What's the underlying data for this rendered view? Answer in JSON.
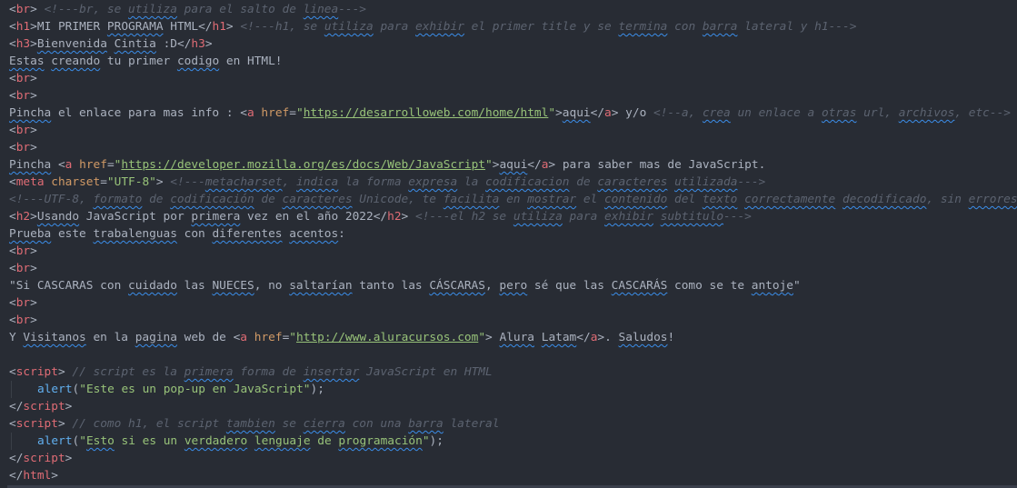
{
  "editor": {
    "theme_colors": {
      "background": "#282c34",
      "tag": "#e06c75",
      "attribute": "#d19a66",
      "string": "#98c379",
      "comment": "#5c6370",
      "text": "#abb2bf",
      "function": "#61afef",
      "spellcheck": "#3b8eea"
    },
    "lines": [
      [
        [
          "punct",
          "<"
        ],
        [
          "tag",
          "br"
        ],
        [
          "punct",
          ">"
        ],
        [
          "text",
          " "
        ],
        [
          "comment",
          "<!---br, se "
        ],
        [
          "comment-spell",
          "utiliza"
        ],
        [
          "comment",
          " para el salto de "
        ],
        [
          "comment-spell",
          "linea"
        ],
        [
          "comment",
          "--->"
        ]
      ],
      [
        [
          "punct",
          "<"
        ],
        [
          "tag",
          "h1"
        ],
        [
          "punct",
          ">"
        ],
        [
          "text",
          "MI PRIMER "
        ],
        [
          "text-spell",
          "PROGRAMA"
        ],
        [
          "text",
          " HTML"
        ],
        [
          "punct",
          "</"
        ],
        [
          "tag",
          "h1"
        ],
        [
          "punct",
          ">"
        ],
        [
          "text",
          " "
        ],
        [
          "comment",
          "<!---h1, se "
        ],
        [
          "comment-spell",
          "utiliza"
        ],
        [
          "comment",
          " para "
        ],
        [
          "comment-spell",
          "exhibir"
        ],
        [
          "comment",
          " el primer title y se "
        ],
        [
          "comment-spell",
          "termina"
        ],
        [
          "comment",
          " con "
        ],
        [
          "comment-spell",
          "barra"
        ],
        [
          "comment",
          " lateral y h1--->"
        ]
      ],
      [
        [
          "punct",
          "<"
        ],
        [
          "tag",
          "h3"
        ],
        [
          "punct",
          ">"
        ],
        [
          "text-spell",
          "Bienvenida"
        ],
        [
          "text",
          " "
        ],
        [
          "text-spell",
          "Cintia"
        ],
        [
          "text",
          " :D"
        ],
        [
          "punct",
          "</"
        ],
        [
          "tag",
          "h3"
        ],
        [
          "punct",
          ">"
        ]
      ],
      [
        [
          "text-spell",
          "Estas"
        ],
        [
          "text",
          " "
        ],
        [
          "text-spell",
          "creando"
        ],
        [
          "text",
          " tu primer "
        ],
        [
          "text-spell",
          "codigo"
        ],
        [
          "text",
          " en HTML!"
        ]
      ],
      [
        [
          "punct",
          "<"
        ],
        [
          "tag",
          "br"
        ],
        [
          "punct",
          ">"
        ]
      ],
      [
        [
          "punct",
          "<"
        ],
        [
          "tag",
          "br"
        ],
        [
          "punct",
          ">"
        ]
      ],
      [
        [
          "text-spell",
          "Pincha"
        ],
        [
          "text",
          " el enlace para mas info : "
        ],
        [
          "punct",
          "<"
        ],
        [
          "tag",
          "a"
        ],
        [
          "text",
          " "
        ],
        [
          "attr",
          "href"
        ],
        [
          "punct",
          "="
        ],
        [
          "str",
          "\""
        ],
        [
          "url",
          "https://desarrolloweb.com/home/html"
        ],
        [
          "str",
          "\""
        ],
        [
          "punct",
          ">"
        ],
        [
          "text-spell",
          "aqui"
        ],
        [
          "punct",
          "</"
        ],
        [
          "tag",
          "a"
        ],
        [
          "punct",
          ">"
        ],
        [
          "text",
          " y/o "
        ],
        [
          "comment",
          "<!--a, "
        ],
        [
          "comment-spell",
          "crea"
        ],
        [
          "comment",
          " un enlace a "
        ],
        [
          "comment-spell",
          "otras"
        ],
        [
          "comment",
          " url, "
        ],
        [
          "comment-spell",
          "archivos"
        ],
        [
          "comment",
          ", etc-->"
        ]
      ],
      [
        [
          "punct",
          "<"
        ],
        [
          "tag",
          "br"
        ],
        [
          "punct",
          ">"
        ]
      ],
      [
        [
          "punct",
          "<"
        ],
        [
          "tag",
          "br"
        ],
        [
          "punct",
          ">"
        ]
      ],
      [
        [
          "text-spell",
          "Pincha"
        ],
        [
          "text",
          " "
        ],
        [
          "punct",
          "<"
        ],
        [
          "tag",
          "a"
        ],
        [
          "text",
          " "
        ],
        [
          "attr",
          "href"
        ],
        [
          "punct",
          "="
        ],
        [
          "str",
          "\""
        ],
        [
          "url",
          "https://developer.mozilla.org/es/docs/Web/JavaScript"
        ],
        [
          "str",
          "\""
        ],
        [
          "punct",
          ">"
        ],
        [
          "text-spell",
          "aqui"
        ],
        [
          "punct",
          "</"
        ],
        [
          "tag",
          "a"
        ],
        [
          "punct",
          ">"
        ],
        [
          "text",
          " para saber mas de JavaScript."
        ]
      ],
      [
        [
          "punct",
          "<"
        ],
        [
          "tag",
          "meta"
        ],
        [
          "text",
          " "
        ],
        [
          "attr",
          "charset"
        ],
        [
          "punct",
          "="
        ],
        [
          "str",
          "\"UTF-8\""
        ],
        [
          "punct",
          ">"
        ],
        [
          "text",
          " "
        ],
        [
          "comment",
          "<!---"
        ],
        [
          "comment-spell",
          "metacharset"
        ],
        [
          "comment",
          ", "
        ],
        [
          "comment-spell",
          "indica"
        ],
        [
          "comment",
          " la forma "
        ],
        [
          "comment-spell",
          "expresa"
        ],
        [
          "comment",
          " la "
        ],
        [
          "comment-spell",
          "codificacion"
        ],
        [
          "comment",
          " de "
        ],
        [
          "comment-spell",
          "caracteres"
        ],
        [
          "comment",
          " "
        ],
        [
          "comment-spell",
          "utilizada"
        ],
        [
          "comment",
          "--->"
        ]
      ],
      [
        [
          "comment",
          "<!---UTF-8, "
        ],
        [
          "comment-spell",
          "formato"
        ],
        [
          "comment",
          " de "
        ],
        [
          "comment-spell",
          "codificación"
        ],
        [
          "comment",
          " de "
        ],
        [
          "comment-spell",
          "caracteres"
        ],
        [
          "comment",
          " Unicode, te "
        ],
        [
          "comment-spell",
          "facilita"
        ],
        [
          "comment",
          " en "
        ],
        [
          "comment-spell",
          "mostrar"
        ],
        [
          "comment",
          " el "
        ],
        [
          "comment-spell",
          "contenido"
        ],
        [
          "comment",
          " del "
        ],
        [
          "comment-spell",
          "texto"
        ],
        [
          "comment",
          " "
        ],
        [
          "comment-spell",
          "correctamente"
        ],
        [
          "comment",
          " "
        ],
        [
          "comment-spell",
          "decodificado"
        ],
        [
          "comment",
          ", sin "
        ],
        [
          "comment-spell",
          "errores"
        ]
      ],
      [
        [
          "punct",
          "<"
        ],
        [
          "tag",
          "h2"
        ],
        [
          "punct",
          ">"
        ],
        [
          "text-spell",
          "Usando"
        ],
        [
          "text",
          " JavaScript por "
        ],
        [
          "text-spell",
          "primera"
        ],
        [
          "text",
          " vez en el año 2022"
        ],
        [
          "punct",
          "</"
        ],
        [
          "tag",
          "h2"
        ],
        [
          "punct",
          ">"
        ],
        [
          "text",
          " "
        ],
        [
          "comment",
          "<!---el h2 se "
        ],
        [
          "comment-spell",
          "utiliza"
        ],
        [
          "comment",
          " para "
        ],
        [
          "comment-spell",
          "exhibir"
        ],
        [
          "comment",
          " "
        ],
        [
          "comment-spell",
          "subtitulo"
        ],
        [
          "comment",
          "--->"
        ]
      ],
      [
        [
          "text-spell",
          "Prueba"
        ],
        [
          "text",
          " este "
        ],
        [
          "text-spell",
          "trabalenguas"
        ],
        [
          "text",
          " con "
        ],
        [
          "text-spell",
          "diferentes"
        ],
        [
          "text",
          " "
        ],
        [
          "text-spell",
          "acentos"
        ],
        [
          "text",
          ":"
        ]
      ],
      [
        [
          "punct",
          "<"
        ],
        [
          "tag",
          "br"
        ],
        [
          "punct",
          ">"
        ]
      ],
      [
        [
          "punct",
          "<"
        ],
        [
          "tag",
          "br"
        ],
        [
          "punct",
          ">"
        ]
      ],
      [
        [
          "text",
          "\"Si CASCARAS con "
        ],
        [
          "text-spell",
          "cuidado"
        ],
        [
          "text",
          " las "
        ],
        [
          "text-spell",
          "NUECES"
        ],
        [
          "text",
          ", no "
        ],
        [
          "text-spell",
          "saltarían"
        ],
        [
          "text",
          " tanto las "
        ],
        [
          "text-spell",
          "CÁSCARAS"
        ],
        [
          "text",
          ", "
        ],
        [
          "text-spell",
          "pero"
        ],
        [
          "text",
          " sé que las "
        ],
        [
          "text-spell",
          "CASCARÁS"
        ],
        [
          "text",
          " como se te "
        ],
        [
          "text-spell",
          "antoje"
        ],
        [
          "text",
          "\""
        ]
      ],
      [
        [
          "punct",
          "<"
        ],
        [
          "tag",
          "br"
        ],
        [
          "punct",
          ">"
        ]
      ],
      [
        [
          "punct",
          "<"
        ],
        [
          "tag",
          "br"
        ],
        [
          "punct",
          ">"
        ]
      ],
      [
        [
          "text",
          "Y "
        ],
        [
          "text-spell",
          "Visitanos"
        ],
        [
          "text",
          " en la "
        ],
        [
          "text-spell",
          "pagina"
        ],
        [
          "text",
          " web de "
        ],
        [
          "punct",
          "<"
        ],
        [
          "tag",
          "a"
        ],
        [
          "text",
          " "
        ],
        [
          "attr",
          "href"
        ],
        [
          "punct",
          "="
        ],
        [
          "str",
          "\""
        ],
        [
          "url",
          "http://www.aluracursos.com"
        ],
        [
          "str",
          "\""
        ],
        [
          "punct",
          ">"
        ],
        [
          "text",
          " "
        ],
        [
          "text-spell",
          "Alura"
        ],
        [
          "text",
          " "
        ],
        [
          "text-spell",
          "Latam"
        ],
        [
          "punct",
          "</"
        ],
        [
          "tag",
          "a"
        ],
        [
          "punct",
          ">"
        ],
        [
          "text",
          ". "
        ],
        [
          "text-spell",
          "Saludos"
        ],
        [
          "text",
          "!"
        ]
      ],
      [],
      [
        [
          "punct",
          "<"
        ],
        [
          "tag",
          "script"
        ],
        [
          "punct",
          ">"
        ],
        [
          "text",
          " "
        ],
        [
          "comment",
          "// script es la "
        ],
        [
          "comment-spell",
          "primera"
        ],
        [
          "comment",
          " forma de "
        ],
        [
          "comment-spell",
          "insertar"
        ],
        [
          "comment",
          " JavaScript en HTML"
        ]
      ],
      [
        [
          "indent",
          ""
        ],
        [
          "func",
          "alert"
        ],
        [
          "punct",
          "("
        ],
        [
          "str",
          "\"Este es un pop-up en JavaScript\""
        ],
        [
          "punct",
          ");"
        ]
      ],
      [
        [
          "punct",
          "</"
        ],
        [
          "tag",
          "script"
        ],
        [
          "punct",
          ">"
        ]
      ],
      [
        [
          "punct",
          "<"
        ],
        [
          "tag",
          "script"
        ],
        [
          "punct",
          ">"
        ],
        [
          "text",
          " "
        ],
        [
          "comment",
          "// como h1, el script "
        ],
        [
          "comment-spell",
          "tambien"
        ],
        [
          "comment",
          " se "
        ],
        [
          "comment-spell",
          "cierra"
        ],
        [
          "comment",
          " con una "
        ],
        [
          "comment-spell",
          "barra"
        ],
        [
          "comment",
          " lateral"
        ]
      ],
      [
        [
          "indent",
          ""
        ],
        [
          "func",
          "alert"
        ],
        [
          "punct",
          "("
        ],
        [
          "str",
          "\""
        ],
        [
          "str-spell",
          "Esto"
        ],
        [
          "str",
          " si es un "
        ],
        [
          "str-spell",
          "verdadero"
        ],
        [
          "str",
          " "
        ],
        [
          "str-spell",
          "lenguaje"
        ],
        [
          "str",
          " de "
        ],
        [
          "str-spell",
          "programación"
        ],
        [
          "str",
          "\""
        ],
        [
          "punct",
          ");"
        ]
      ],
      [
        [
          "punct",
          "</"
        ],
        [
          "tag",
          "script"
        ],
        [
          "punct",
          ">"
        ]
      ],
      [
        [
          "punct",
          "</"
        ],
        [
          "tag",
          "html"
        ],
        [
          "punct",
          ">"
        ]
      ]
    ]
  }
}
